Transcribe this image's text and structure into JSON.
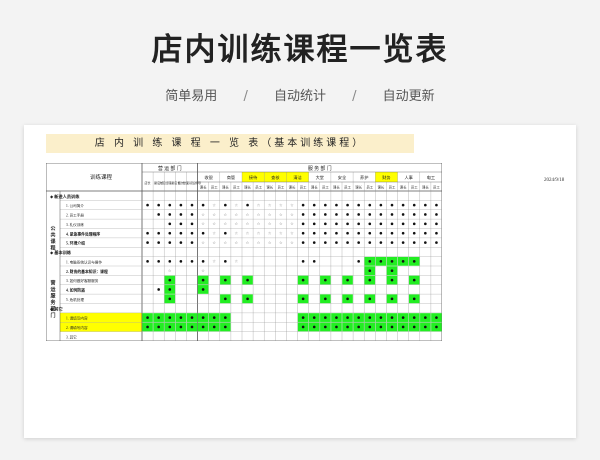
{
  "hero": {
    "title": "店内训练课程一览表",
    "tags": [
      "简单易用",
      "自动统计",
      "自动更新"
    ],
    "separator": "/"
  },
  "sheet": {
    "title": "店 内 训 练 课 程 一 览 表（基本训练课程）",
    "date": "2024/9/18",
    "header": {
      "course_col": "训练课程",
      "dept_a": "营 运 部 门",
      "dept_b": "服 务 部 门",
      "ops_subs": [
        "店长",
        "副店长",
        "大区经理副店长",
        "组长",
        "楼面领班督导"
      ],
      "groups": [
        {
          "name": "收银",
          "hl": false
        },
        {
          "name": "商管",
          "hl": false
        },
        {
          "name": "接待",
          "hl": true
        },
        {
          "name": "查核",
          "hl": true
        },
        {
          "name": "清洁",
          "hl": true
        },
        {
          "name": "大堂",
          "hl": false
        },
        {
          "name": "安全",
          "hl": false
        },
        {
          "name": "养护",
          "hl": false
        },
        {
          "name": "财务",
          "hl": true
        },
        {
          "name": "人事",
          "hl": false
        },
        {
          "name": "电工",
          "hl": false
        },
        {
          "name": "IGC",
          "hl": false
        }
      ],
      "sub_pair": [
        "课长",
        "员工"
      ]
    },
    "left_groups": [
      {
        "label": "公共课程",
        "start": 3,
        "end": 8
      },
      {
        "label": "营运服务部门",
        "start": 10,
        "end": 14
      }
    ],
    "rows": [
      {
        "name": "新进人员训练",
        "kind": "section",
        "hl": false,
        "cells": []
      },
      {
        "name": "1. 公司简介",
        "kind": "item",
        "hl": false,
        "cells": [
          "D",
          "D",
          "D",
          "D",
          "D",
          "D",
          "S",
          "D",
          "S",
          "D",
          "S",
          "S",
          "S",
          "S",
          "D",
          "D",
          "D",
          "D",
          "D",
          "D",
          "D",
          "D",
          "D",
          "D",
          "D",
          "D",
          "D"
        ]
      },
      {
        "name": "2. 员工手册",
        "kind": "item",
        "hl": false,
        "cells": [
          "",
          "D",
          "D",
          "D",
          "D",
          "S",
          "S",
          "S",
          "S",
          "S",
          "S",
          "S",
          "S",
          "S",
          "D",
          "D",
          "D",
          "D",
          "D",
          "D",
          "D",
          "D",
          "D",
          "D",
          "D",
          "D",
          "D"
        ]
      },
      {
        "name": "3. 礼仪训练",
        "kind": "item",
        "hl": false,
        "cells": [
          "",
          "",
          "D",
          "D",
          "D",
          "S",
          "S",
          "S",
          "S",
          "S",
          "S",
          "S",
          "S",
          "S",
          "D",
          "D",
          "D",
          "D",
          "D",
          "D",
          "D",
          "D",
          "D",
          "D",
          "D",
          "D",
          "D"
        ]
      },
      {
        "name": "4. 紧急事件处理程序",
        "kind": "bold",
        "hl": false,
        "cells": [
          "D",
          "D",
          "D",
          "D",
          "D",
          "D",
          "S",
          "D",
          "S",
          "S",
          "S",
          "S",
          "S",
          "S",
          "D",
          "D",
          "D",
          "D",
          "D",
          "D",
          "D",
          "D",
          "D",
          "D",
          "D",
          "D",
          "D"
        ]
      },
      {
        "name": "5. 环境介绍",
        "kind": "bold",
        "hl": false,
        "cells": [
          "D",
          "D",
          "D",
          "D",
          "D",
          "S",
          "S",
          "S",
          "S",
          "S",
          "S",
          "S",
          "S",
          "S",
          "D",
          "D",
          "D",
          "D",
          "D",
          "D",
          "D",
          "D",
          "D",
          "D",
          "D",
          "D",
          "D"
        ]
      },
      {
        "name": "基本训练",
        "kind": "section",
        "hl": false,
        "cells": []
      },
      {
        "name": "1. 电脑系统认识与操作",
        "kind": "item",
        "hl": false,
        "cells": [
          "D",
          "D",
          "D",
          "D",
          "D",
          "D",
          "S",
          "D",
          "S",
          "",
          "",
          "",
          "",
          "",
          "D",
          "D",
          "",
          "",
          "",
          "D",
          "G",
          "G",
          "G",
          "G",
          "G",
          "",
          ""
        ]
      },
      {
        "name": "2. 财务的基本知识：课程",
        "kind": "bold",
        "hl": false,
        "cells": [
          "",
          "",
          "S",
          "",
          "",
          "S",
          "",
          "",
          "",
          "",
          "",
          "",
          "",
          "",
          "",
          "",
          "",
          "",
          "",
          "",
          "G",
          "",
          "G",
          "",
          "",
          "",
          ""
        ]
      },
      {
        "name": "3. 如何做好客服服务",
        "kind": "item",
        "hl": false,
        "cells": [
          "",
          "",
          "G",
          "",
          "",
          "G",
          "",
          "G",
          "",
          "G",
          "",
          "",
          "",
          "",
          "G",
          "",
          "G",
          "",
          "G",
          "",
          "G",
          "",
          "G",
          "",
          "G",
          "",
          ""
        ]
      },
      {
        "name": "4. 如何防盗",
        "kind": "bold",
        "hl": false,
        "cells": [
          "",
          "D",
          "G",
          "",
          "",
          "G",
          "",
          "",
          "",
          "",
          "",
          "",
          "",
          "",
          "",
          "",
          "",
          "",
          "",
          "",
          "",
          "",
          "",
          "",
          "",
          "",
          ""
        ]
      },
      {
        "name": "5. 危机处理",
        "kind": "item",
        "hl": false,
        "cells": [
          "",
          "",
          "G",
          "",
          "",
          "",
          "",
          "G",
          "",
          "G",
          "",
          "",
          "",
          "",
          "G",
          "",
          "G",
          "",
          "G",
          "",
          "G",
          "",
          "G",
          "",
          "G",
          "",
          ""
        ]
      },
      {
        "name": "其它",
        "kind": "section",
        "hl": false,
        "cells": []
      },
      {
        "name": "1. 请填写内容",
        "kind": "item",
        "hl": true,
        "cells": [
          "G",
          "G",
          "G",
          "G",
          "G",
          "G",
          "G",
          "G",
          "",
          "",
          "",
          "",
          "",
          "",
          "G",
          "G",
          "G",
          "G",
          "G",
          "G",
          "G",
          "G",
          "G",
          "G",
          "G",
          "G",
          "G"
        ]
      },
      {
        "name": "2. 请填写内容",
        "kind": "item",
        "hl": true,
        "cells": [
          "G",
          "G",
          "G",
          "G",
          "G",
          "G",
          "G",
          "G",
          "",
          "",
          "",
          "",
          "",
          "",
          "G",
          "G",
          "G",
          "G",
          "G",
          "G",
          "G",
          "G",
          "G",
          "G",
          "G",
          "G",
          "G"
        ]
      },
      {
        "name": "3. 其它",
        "kind": "item",
        "hl": false,
        "cells": []
      }
    ]
  },
  "colors": {
    "green": "#22ee22",
    "yellow": "#ffff00",
    "title_bg": "#fbefcb"
  }
}
